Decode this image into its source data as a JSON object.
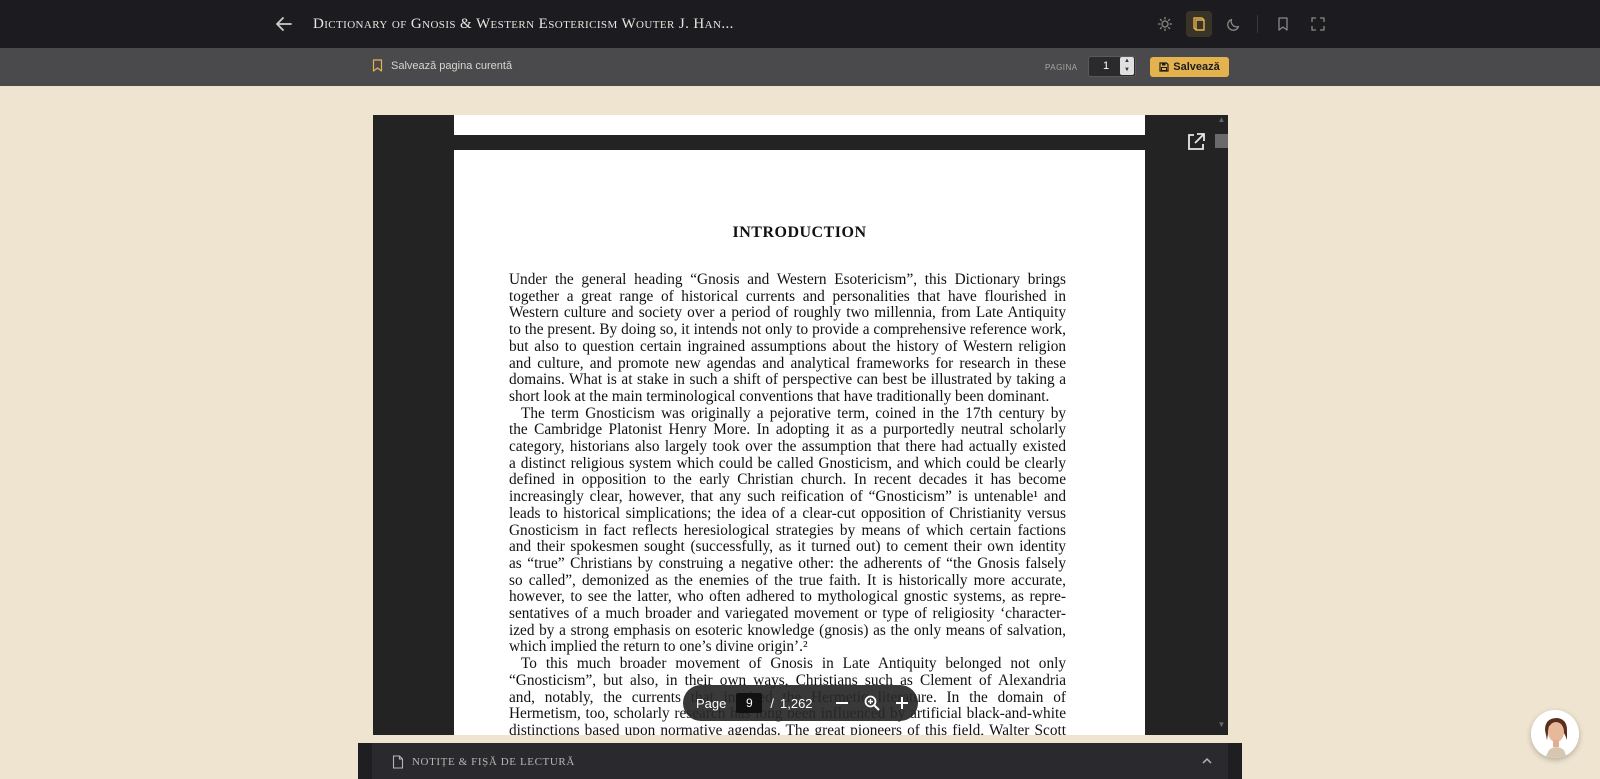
{
  "topbar": {
    "title": "Dictionary of Gnosis & Western Esotericism Wouter J. Han...",
    "icons": [
      "back-arrow-icon",
      "sun-icon",
      "book-icon",
      "moon-icon",
      "bookmark-icon",
      "fullscreen-icon"
    ],
    "accent": "#e4b34e"
  },
  "subbar": {
    "save_page_label": "Salvează pagina curentă",
    "page_label": "PAGINA",
    "page_value": "1",
    "save_button_label": "Salvează"
  },
  "document": {
    "heading": "INTRODUCTION",
    "paragraphs": [
      [
        "Under the general heading “Gnosis and Western Esotericism”, this Dictionary brings",
        "together a great range of historical currents and personalities that have flourished in",
        "Western culture and society over a period of roughly two millennia, from Late Antiquity",
        "to the present. By doing so, it intends not only to provide a comprehensive reference work,",
        "but also to question certain ingrained assumptions about the history of Western religion",
        "and culture, and promote new agendas and analytical frameworks for research in these",
        "domains. What is at stake in such a shift of perspective can best be illustrated by taking a",
        "short look at the main terminological conventions that have traditionally been dominant."
      ],
      [
        "The term Gnosticism was originally a pejorative term, coined in the 17th century by",
        "the Cambridge Platonist Henry More. In adopting it as a purportedly neutral scholarly",
        "category, historians also largely took over the assumption that there had actually existed",
        "a distinct religious system which could be called Gnosticism, and which could be clearly",
        "defined in opposition to the early Christian church. In recent decades it has become",
        "increasingly clear, however, that any such reification of “Gnosticism” is untenable¹ and",
        "leads to historical simplications; the idea of a clear-cut opposition of Christianity versus",
        "Gnosticism in fact reflects heresiological strategies by means of which certain factions",
        "and their spokesmen sought (successfully, as it turned out) to cement their own identity",
        "as “true” Christians by construing a negative other: the adherents of “the Gnosis falsely",
        "so called”, demonized as the enemies of the true faith. It is historically more accurate,",
        "however, to see the latter, who often adhered to mythological gnostic systems, as repre-",
        "sentatives of a much broader and variegated movement or type of religiosity ‘character-",
        "ized by a strong emphasis on esoteric knowledge (gnosis) as the only means of salvation,",
        "which implied the return to one’s divine origin’.²"
      ],
      [
        "To this much broader movement of Gnosis in Late Antiquity belonged not only",
        "“Gnosticism”, but also, in their own ways, Christians such as Clement of Alexandria",
        "and, notably, the currents that inspired the Hermetic literature. In the domain of",
        "Hermetism, too, scholarly research has long been influenced by artificial black-and-white",
        "distinctions based upon normative agendas. The great pioneers of this field, Walter Scott"
      ]
    ]
  },
  "zoom_bar": {
    "page_label": "Page",
    "current_page": "9",
    "separator": "/",
    "total_pages": "1,262"
  },
  "notes_panel": {
    "title": "NOTIȚE & FIȘĂ DE LECTURĂ"
  }
}
